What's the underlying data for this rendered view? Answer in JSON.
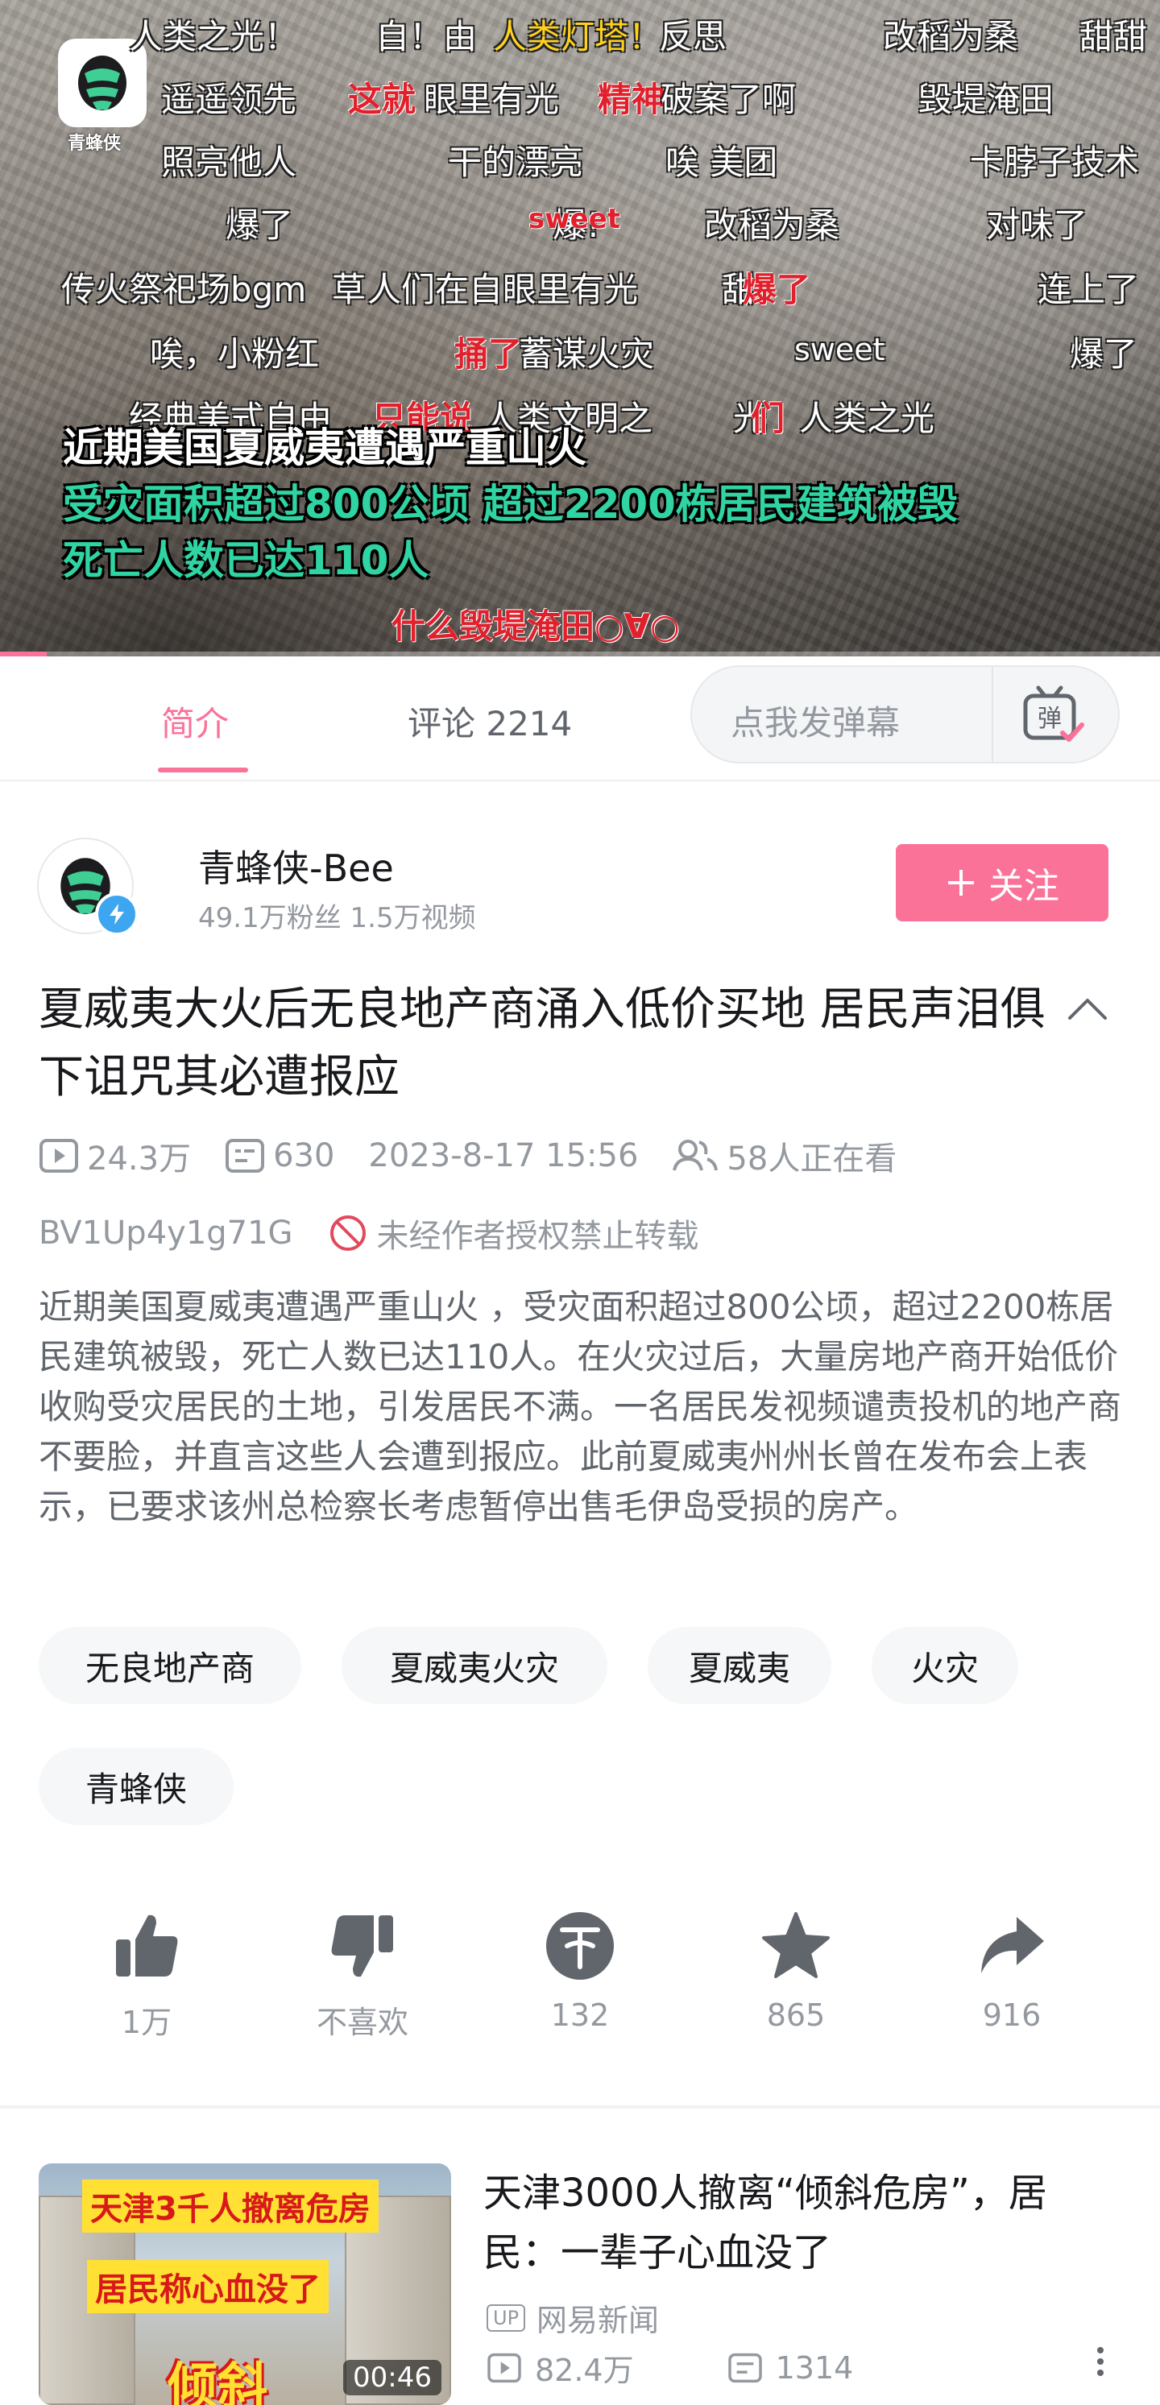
{
  "player": {
    "logo_text": "青蜂侠",
    "progress_percent": 4,
    "danmaku": [
      {
        "text": "人类之光！",
        "style": "white"
      },
      {
        "text": "自！由",
        "style": "white"
      },
      {
        "text": "人类灯塔！",
        "style": "yellow"
      },
      {
        "text": "反思",
        "style": "white"
      },
      {
        "text": "改稻为桑",
        "style": "white"
      },
      {
        "text": "甜甜",
        "style": "white"
      },
      {
        "text": "遥遥领先",
        "style": "white"
      },
      {
        "text": "这就",
        "style": "red"
      },
      {
        "text": "眼里有光",
        "style": "white"
      },
      {
        "text": "精神",
        "style": "red"
      },
      {
        "text": "破案了啊",
        "style": "white"
      },
      {
        "text": "毁堤淹田",
        "style": "white"
      },
      {
        "text": "照亮他人",
        "style": "white"
      },
      {
        "text": "干的漂亮",
        "style": "white"
      },
      {
        "text": "唉 美团",
        "style": "white"
      },
      {
        "text": "卡脖子技术",
        "style": "white"
      },
      {
        "text": "爆了",
        "style": "white"
      },
      {
        "text": "爆!",
        "style": "white"
      },
      {
        "text": "sweet",
        "style": "red"
      },
      {
        "text": "改稻为桑",
        "style": "white"
      },
      {
        "text": "对味了",
        "style": "white"
      },
      {
        "text": "传火祭祀场bgm",
        "style": "white"
      },
      {
        "text": "草",
        "style": "white"
      },
      {
        "text": "人们在自眼里有光",
        "style": "white"
      },
      {
        "text": "甜",
        "style": "white"
      },
      {
        "text": "爆了",
        "style": "red"
      },
      {
        "text": "连上了",
        "style": "white"
      },
      {
        "text": "唉，小粉红",
        "style": "white"
      },
      {
        "text": "捅了",
        "style": "red"
      },
      {
        "text": "蓄谋火灾",
        "style": "white"
      },
      {
        "text": "sweet",
        "style": "white"
      },
      {
        "text": "爆了",
        "style": "white"
      },
      {
        "text": "经典美式自由",
        "style": "white"
      },
      {
        "text": "只能说",
        "style": "red"
      },
      {
        "text": "人类文明之",
        "style": "white"
      },
      {
        "text": "光",
        "style": "white"
      },
      {
        "text": "们",
        "style": "red"
      },
      {
        "text": "人类之光",
        "style": "white"
      },
      {
        "text": "什么毁堤淹田○∀○",
        "style": "red"
      }
    ],
    "subtitles": [
      {
        "text": "近期美国夏威夷遭遇严重山火",
        "color": "#ffffff"
      },
      {
        "text": "受灾面积超过800公顷 超过2200栋居民建筑被毁",
        "color": "#2fd4a2"
      },
      {
        "text": "死亡人数已达110人",
        "color": "#2fd4a2"
      }
    ]
  },
  "tabs": [
    {
      "label": "简介",
      "active": true
    },
    {
      "label": "评论 2214",
      "active": false
    }
  ],
  "danmaku_input": {
    "placeholder": "点我发弹幕",
    "icon_text": "弹"
  },
  "uploader": {
    "name": "青蜂侠-Bee",
    "stats": "49.1万粉丝   1.5万视频",
    "follow_label": "关注"
  },
  "video": {
    "title": "夏威夷大火后无良地产商涌入低价买地 居民声泪俱下诅咒其必遭报应",
    "views": "24.3万",
    "danmaku_count": "630",
    "date": "2023-8-17 15:56",
    "watching": "58人正在看",
    "bvid": "BV1Up4y1g71G",
    "repost_notice": "未经作者授权禁止转载",
    "description": "近期美国夏威夷遭遇严重山火 ，受灾面积超过800公顷，超过2200栋居民建筑被毁，死亡人数已达110人。在火灾过后，大量房地产商开始低价收购受灾居民的土地，引发居民不满。一名居民发视频谴责投机的地产商不要脸，并直言这些人会遭到报应。此前夏威夷州州长曾在发布会上表示，已要求该州总检察长考虑暂停出售毛伊岛受损的房产。"
  },
  "tags": [
    "无良地产商",
    "夏威夷火灾",
    "夏威夷",
    "火灾",
    "青蜂侠"
  ],
  "actions": [
    {
      "icon": "thumb-up-icon",
      "label": "1万"
    },
    {
      "icon": "thumb-down-icon",
      "label": "不喜欢"
    },
    {
      "icon": "coin-icon",
      "label": "132"
    },
    {
      "icon": "star-icon",
      "label": "865"
    },
    {
      "icon": "share-icon",
      "label": "916"
    }
  ],
  "recommended": {
    "title": "天津3000人撤离“倾斜危房”，居民：一辈子心血没了",
    "up_badge": "UP",
    "uploader": "网易新闻",
    "duration": "00:46",
    "thumb_caption_1": "天津3千人撤离危房",
    "thumb_caption_2": "居民称心血没了",
    "thumb_caption_3": "倾斜",
    "views": "82.4万",
    "danmaku_count": "1314"
  },
  "colors": {
    "accent": "#fb7299",
    "muted": "#9499a0",
    "text": "#18191c",
    "verify": "#3ea6f0"
  }
}
